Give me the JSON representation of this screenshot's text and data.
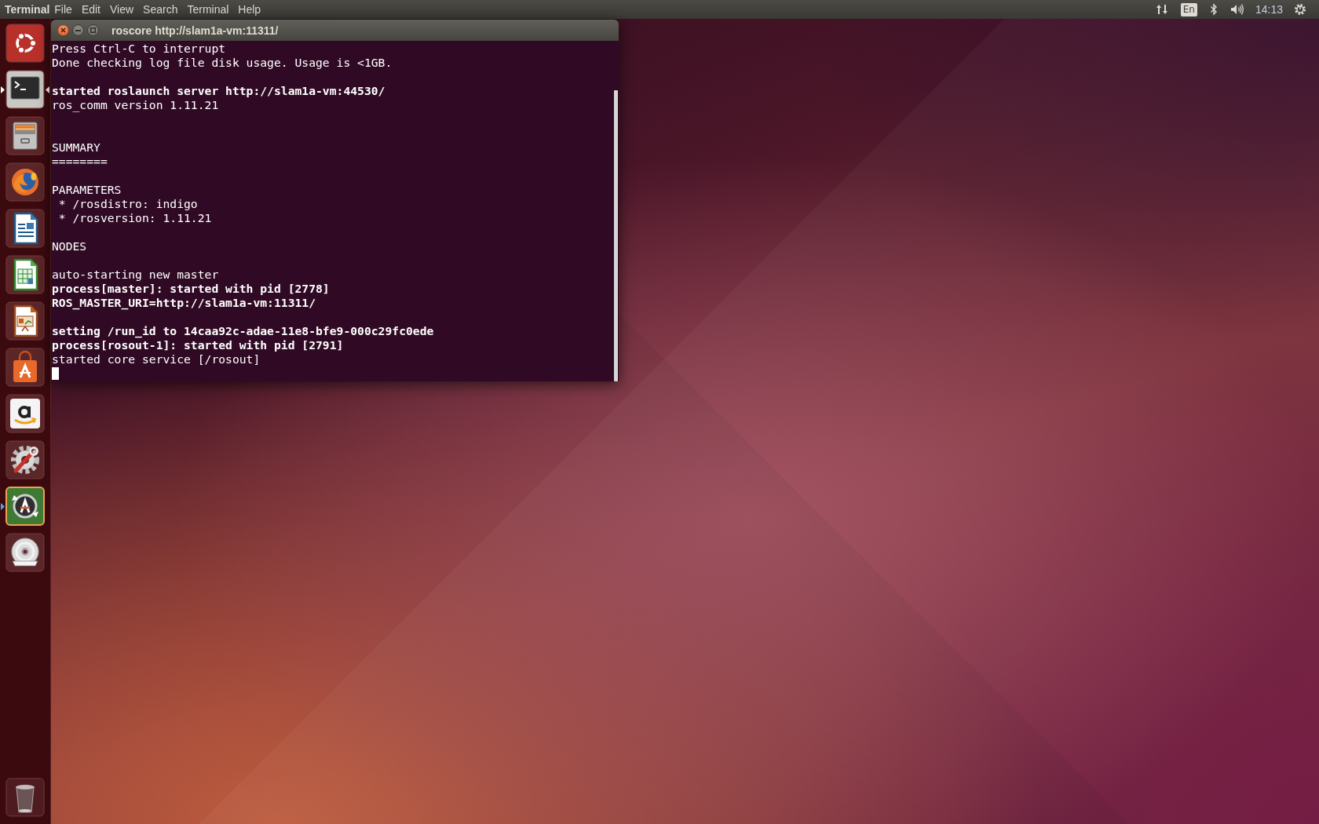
{
  "top_bar": {
    "app_name": "Terminal",
    "menus": [
      "File",
      "Edit",
      "View",
      "Search",
      "Terminal",
      "Help"
    ],
    "keyboard_layout": "En",
    "clock": "14:13"
  },
  "launcher": {
    "items": [
      {
        "kind": "dash",
        "running": false,
        "focused": false,
        "urgent": false
      },
      {
        "kind": "terminal",
        "running": true,
        "focused": true,
        "urgent": false
      },
      {
        "kind": "files",
        "running": false,
        "focused": false,
        "urgent": false
      },
      {
        "kind": "browser",
        "running": false,
        "focused": false,
        "urgent": false
      },
      {
        "kind": "writer",
        "running": false,
        "focused": false,
        "urgent": false
      },
      {
        "kind": "calc",
        "running": false,
        "focused": false,
        "urgent": false
      },
      {
        "kind": "impress",
        "running": false,
        "focused": false,
        "urgent": false
      },
      {
        "kind": "store",
        "running": false,
        "focused": false,
        "urgent": false
      },
      {
        "kind": "amazon",
        "running": false,
        "focused": false,
        "urgent": false
      },
      {
        "kind": "settings",
        "running": false,
        "focused": false,
        "urgent": false
      },
      {
        "kind": "updater",
        "running": true,
        "focused": false,
        "urgent": true
      },
      {
        "kind": "disc",
        "running": false,
        "focused": false,
        "urgent": false
      },
      {
        "kind": "trash",
        "running": false,
        "focused": false,
        "urgent": false
      }
    ]
  },
  "window": {
    "title": "roscore http://slam1a-vm:11311/",
    "focused": true,
    "cursor_shown": true,
    "lines": [
      {
        "kind": "text",
        "text": "Press Ctrl-C to interrupt",
        "bold": false
      },
      {
        "kind": "text",
        "text": "Done checking log file disk usage. Usage is <1GB.",
        "bold": false
      },
      {
        "kind": "blank"
      },
      {
        "kind": "text",
        "text": "started roslaunch server http://slam1a-vm:44530/",
        "bold": true
      },
      {
        "kind": "text",
        "text": "ros_comm version 1.11.21",
        "bold": false
      },
      {
        "kind": "blank"
      },
      {
        "kind": "blank"
      },
      {
        "kind": "text",
        "text": "SUMMARY",
        "bold": false
      },
      {
        "kind": "text",
        "text": "========",
        "bold": false
      },
      {
        "kind": "blank"
      },
      {
        "kind": "text",
        "text": "PARAMETERS",
        "bold": false
      },
      {
        "kind": "text",
        "text": " * /rosdistro: indigo",
        "bold": false
      },
      {
        "kind": "text",
        "text": " * /rosversion: 1.11.21",
        "bold": false
      },
      {
        "kind": "blank"
      },
      {
        "kind": "text",
        "text": "NODES",
        "bold": false
      },
      {
        "kind": "blank"
      },
      {
        "kind": "text",
        "text": "auto-starting new master",
        "bold": false
      },
      {
        "kind": "text",
        "text": "process[master]: started with pid [2778]",
        "bold": true
      },
      {
        "kind": "text",
        "text": "ROS_MASTER_URI=http://slam1a-vm:11311/",
        "bold": true
      },
      {
        "kind": "blank"
      },
      {
        "kind": "text",
        "text": "setting /run_id to 14caa92c-adae-11e8-bfe9-000c29fc0ede",
        "bold": true
      },
      {
        "kind": "text",
        "text": "process[rosout-1]: started with pid [2791]",
        "bold": true
      },
      {
        "kind": "text",
        "text": "started core service [/rosout]",
        "bold": false
      }
    ]
  }
}
